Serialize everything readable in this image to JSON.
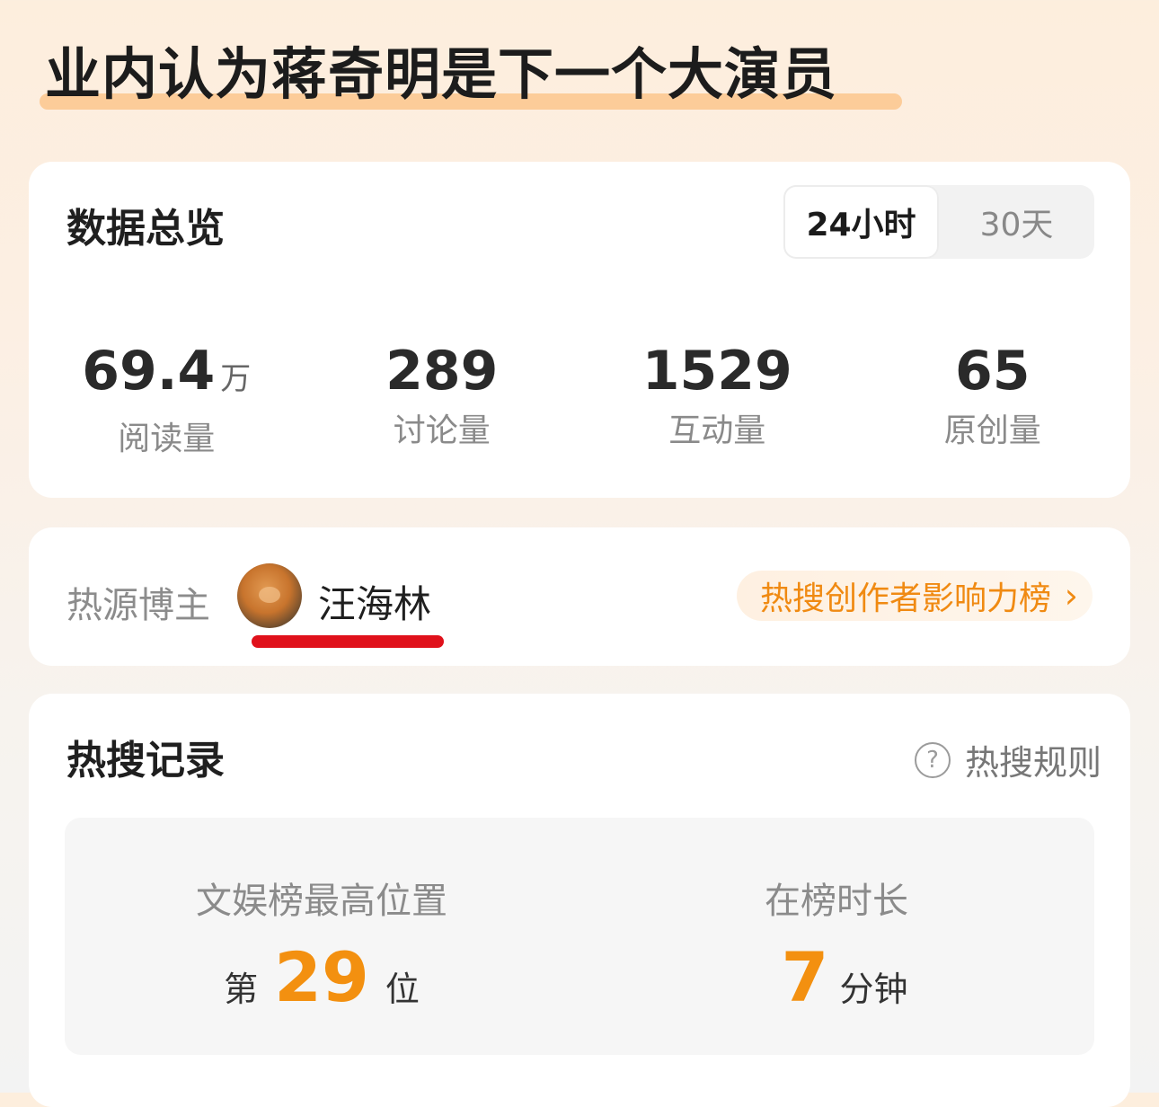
{
  "headline": "业内认为蒋奇明是下一个大演员",
  "overview": {
    "title": "数据总览",
    "tabs": [
      "24小时",
      "30天"
    ],
    "active_tab": "24小时",
    "stats": [
      {
        "value": "69.4",
        "unit": "万",
        "label": "阅读量"
      },
      {
        "value": "289",
        "unit": "",
        "label": "讨论量"
      },
      {
        "value": "1529",
        "unit": "",
        "label": "互动量"
      },
      {
        "value": "65",
        "unit": "",
        "label": "原创量"
      }
    ]
  },
  "source": {
    "label": "热源博主",
    "name": "汪海林",
    "rank_link": "热搜创作者影响力榜",
    "rank_chevron": "›",
    "avatar_icon": "avatar-cat-icon"
  },
  "records": {
    "title": "热搜记录",
    "rules_label": "热搜规则",
    "rules_icon": "?",
    "highest_position": {
      "title": "文娱榜最高位置",
      "prefix": "第",
      "value": "29",
      "suffix": "位"
    },
    "duration": {
      "title": "在榜时长",
      "value": "7",
      "suffix": "分钟"
    }
  },
  "colors": {
    "accent": "#f39010",
    "highlight": "#fbc68d",
    "underline": "#e0111b"
  }
}
